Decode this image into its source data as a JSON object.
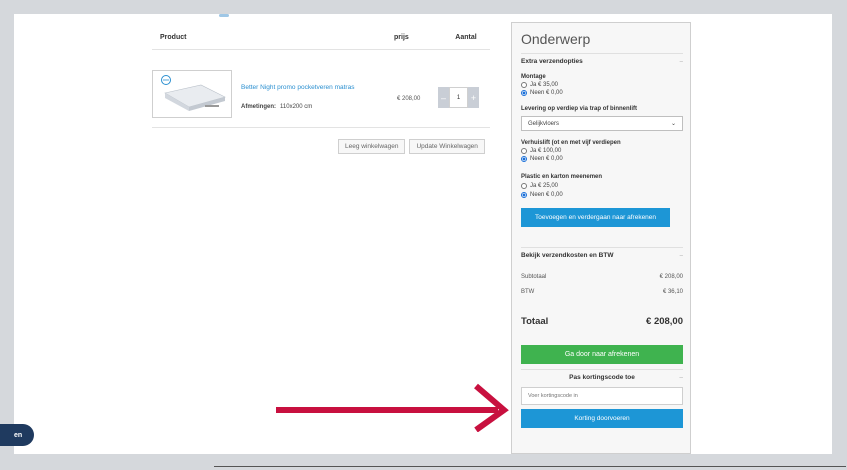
{
  "cart": {
    "headers": {
      "product": "Product",
      "price": "prijs",
      "quantity": "Aantal"
    },
    "item": {
      "name": "Better Night promo pocketveren matras",
      "attr_label": "Afmetingen:",
      "attr_value": "110x200 cm",
      "price": "€ 208,00",
      "quantity": "1"
    },
    "actions": {
      "empty": "Leeg winkelwagen",
      "update": "Update Winkelwagen"
    }
  },
  "sidebar": {
    "title": "Onderwerp",
    "extra": {
      "heading": "Extra verzendopties",
      "montage": {
        "label": "Montage",
        "yes": "Ja € 35,00",
        "no": "Neen € 0,00"
      },
      "delivery": {
        "label": "Levering op verdiep via trap of binnenlift",
        "selected": "Gelijkvloers"
      },
      "lift": {
        "label": "Verhuislift (ot en met vijf verdiepen",
        "yes": "Ja € 100,00",
        "no": "Neen € 0,00"
      },
      "plastic": {
        "label": "Plastic en karton meenemen",
        "yes": "Ja € 25,00",
        "no": "Neen € 0,00"
      },
      "submit": "Toevoegen en verdergaan naar afrekenen"
    },
    "shipping": {
      "heading": "Bekijk verzendkosten en BTW"
    },
    "summary": {
      "subtotal_label": "Subtotaal",
      "subtotal": "€ 208,00",
      "vat_label": "BTW",
      "vat": "€ 36,10",
      "total_label": "Totaal",
      "total": "€ 208,00"
    },
    "checkout": "Ga door naar afrekenen",
    "coupon": {
      "heading": "Pas kortingscode toe",
      "placeholder": "Voer kortingscode in",
      "apply": "Korting doorvoeren"
    }
  },
  "chat": {
    "label": "en"
  },
  "colors": {
    "accent_blue": "#1d96d6",
    "checkout_green": "#3fb34f",
    "arrow_red": "#c8103f"
  }
}
